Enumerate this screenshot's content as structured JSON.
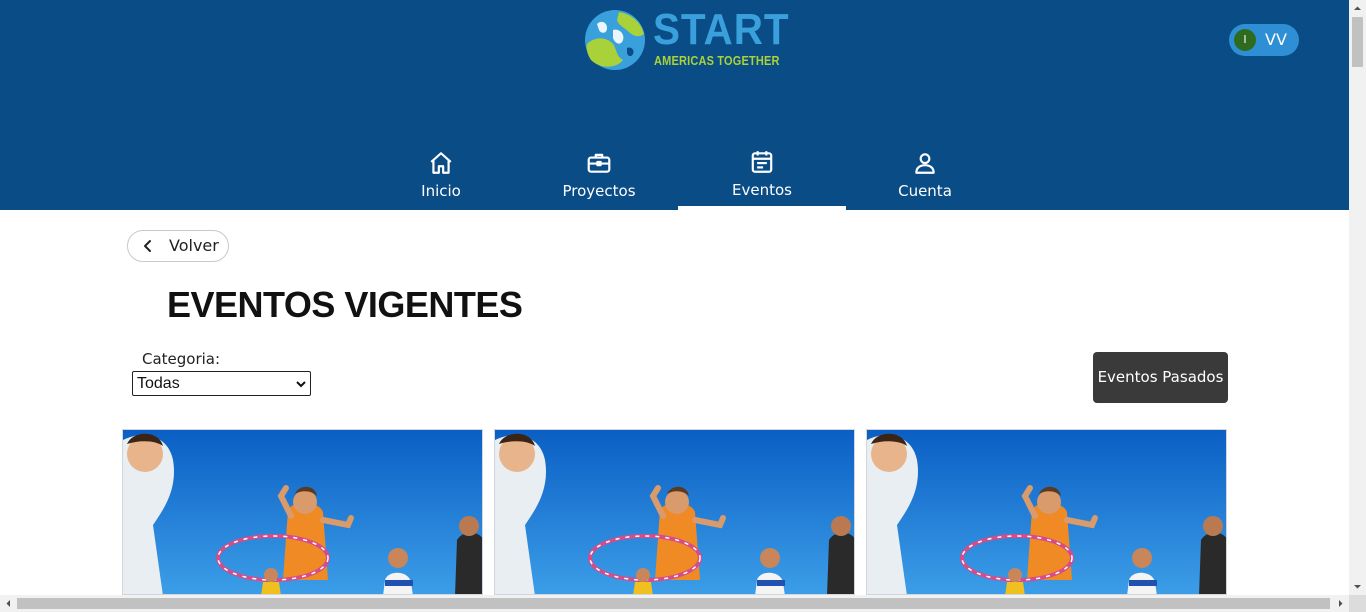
{
  "brand": {
    "name": "START",
    "tagline": "AMERICAS TOGETHER",
    "colors": {
      "header": "#0a4c86",
      "word": "#3aa0dc",
      "tagline": "#a9d23a"
    }
  },
  "user": {
    "status_letter": "I",
    "initials": "VV"
  },
  "nav": {
    "items": [
      {
        "label": "Inicio",
        "icon": "home-icon",
        "active": false
      },
      {
        "label": "Proyectos",
        "icon": "briefcase-icon",
        "active": false
      },
      {
        "label": "Eventos",
        "icon": "calendar-icon",
        "active": true
      },
      {
        "label": "Cuenta",
        "icon": "user-icon",
        "active": false
      }
    ]
  },
  "back": {
    "label": "Volver"
  },
  "page": {
    "title": "EVENTOS VIGENTES"
  },
  "filter": {
    "label": "Categoria:",
    "selected": "Todas"
  },
  "actions": {
    "past_events": "Eventos Pasados"
  },
  "events": {
    "cards": [
      {
        "image": "children-hula-hoop-photo"
      },
      {
        "image": "children-hula-hoop-photo"
      },
      {
        "image": "children-hula-hoop-photo"
      }
    ]
  }
}
